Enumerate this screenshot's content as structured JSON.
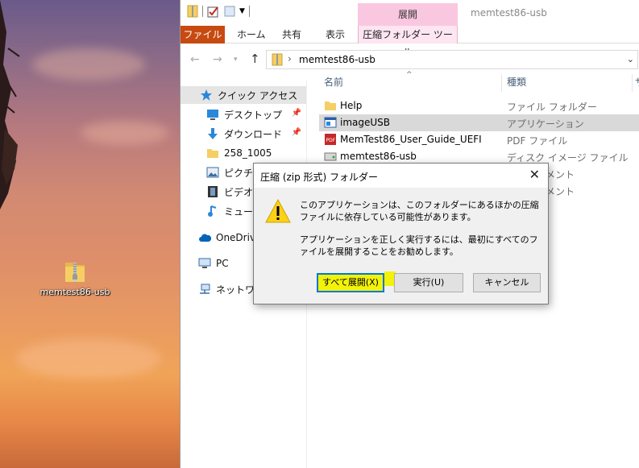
{
  "desktop": {
    "icon_label": "memtest86-usb",
    "icon": "zip-folder-icon"
  },
  "explorer": {
    "title": "memtest86-usb",
    "context_tab_header": "展開",
    "ribbon_tabs": {
      "file": "ファイル",
      "home": "ホーム",
      "share": "共有",
      "view": "表示",
      "compressed_tools": "圧縮フォルダー ツール"
    },
    "address": {
      "path": "memtest86-usb"
    },
    "nav": {
      "quick_access": "クイック アクセス",
      "desktop": "デスクトップ",
      "downloads": "ダウンロード",
      "folder_258": "258_1005",
      "pictures": "ピクチャ",
      "videos": "ビデオ",
      "music": "ミュージック",
      "onedrive": "OneDrive",
      "pc": "PC",
      "network": "ネットワーク"
    },
    "columns": {
      "name": "名前",
      "type": "種類",
      "extra": "サ"
    },
    "files": [
      {
        "name": "Help",
        "type": "ファイル フォルダー",
        "icon": "folder-icon"
      },
      {
        "name": "imageUSB",
        "type": "アプリケーション",
        "icon": "application-icon"
      },
      {
        "name": "MemTest86_User_Guide_UEFI",
        "type": "PDF ファイル",
        "icon": "pdf-icon"
      },
      {
        "name": "memtest86-usb",
        "type": "ディスク イメージ ファイル",
        "icon": "disk-image-icon"
      },
      {
        "name": "",
        "type": "キュメント",
        "icon": ""
      },
      {
        "name": "",
        "type": "キュメント",
        "icon": ""
      }
    ]
  },
  "dialog": {
    "title": "圧縮 (zip 形式) フォルダー",
    "message1": "このアプリケーションは、このフォルダーにあるほかの圧縮ファイルに依存している可能性があります。",
    "message2": "アプリケーションを正しく実行するには、最初にすべてのファイルを展開することをお勧めします。",
    "buttons": {
      "extract_all": "すべて展開(X)",
      "run": "実行(U)",
      "cancel": "キャンセル"
    },
    "highlight_color": "#f2f20a",
    "focus_color": "#0078d7"
  },
  "colors": {
    "file_tab": "#c74a10",
    "context_tab": "#fac7e0"
  }
}
